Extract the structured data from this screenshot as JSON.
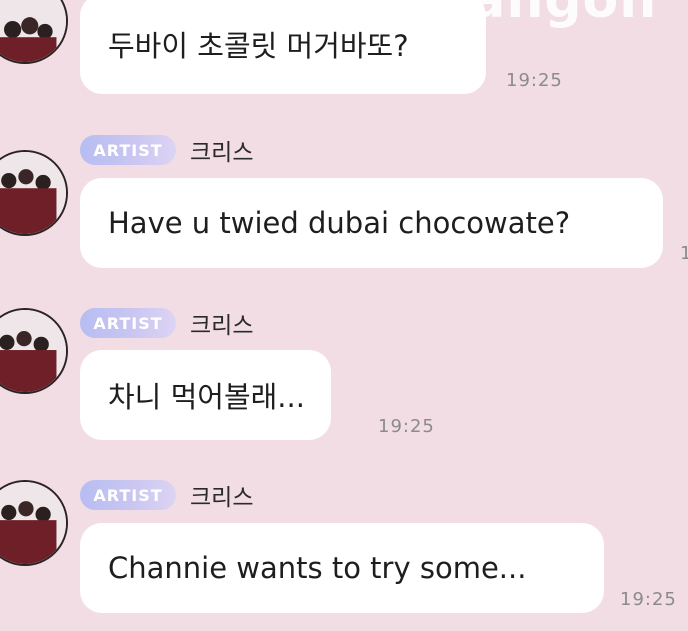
{
  "watermark": "bangon",
  "messages": [
    {
      "badge": "",
      "sender": "",
      "text": "두바이 초콜릿 머거바또?",
      "time": "19:25"
    },
    {
      "badge": "ARTIST",
      "sender": "크리스",
      "text": "Have u twied dubai chocowate?",
      "time": "1"
    },
    {
      "badge": "ARTIST",
      "sender": "크리스",
      "text": "차니 먹어볼래...",
      "time": "19:25"
    },
    {
      "badge": "ARTIST",
      "sender": "크리스",
      "text": "Channie wants to try some...",
      "time": "19:25"
    }
  ],
  "colors": {
    "background": "#f1dde3",
    "bubble": "#ffffff",
    "badge_start": "#b7bdf2",
    "badge_end": "#ddd4f4",
    "time": "#8b8b8b"
  }
}
